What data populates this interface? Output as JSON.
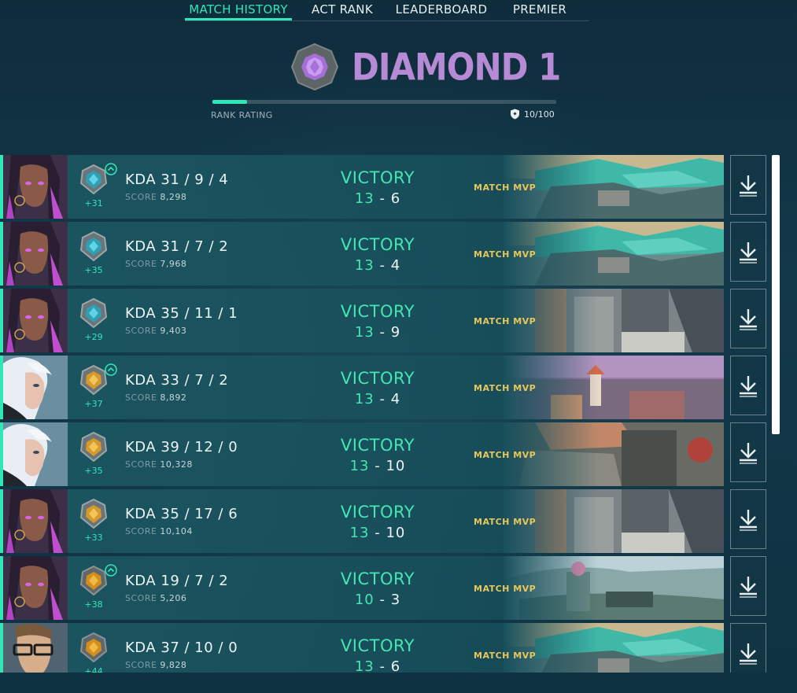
{
  "tabs": [
    {
      "label": "MATCH HISTORY",
      "active": true
    },
    {
      "label": "ACT RANK",
      "active": false
    },
    {
      "label": "LEADERBOARD",
      "active": false
    },
    {
      "label": "PREMIER",
      "active": false
    }
  ],
  "rank": {
    "name": "DIAMOND 1",
    "rating_label": "RANK RATING",
    "rating_value": "10/100",
    "rating_fraction": 0.1,
    "color": "#b78ad6"
  },
  "colors": {
    "accent": "#2ee8b8",
    "victory": "#45e5b4",
    "mvp": "#e6c75c"
  },
  "matches": [
    {
      "agent": "reyna",
      "badge": "platinum",
      "promoted": true,
      "rr": "+31",
      "kda": "KDA 31 / 9 / 4",
      "score_label": "SCORE",
      "score": "8,298",
      "result": "VICTORY",
      "team_score": "13",
      "sep": "-",
      "enemy_score": "6",
      "mvp": "MATCH MVP",
      "map": "ascent"
    },
    {
      "agent": "reyna",
      "badge": "platinum",
      "promoted": false,
      "rr": "+35",
      "kda": "KDA 31 / 7 / 2",
      "score_label": "SCORE",
      "score": "7,968",
      "result": "VICTORY",
      "team_score": "13",
      "sep": "-",
      "enemy_score": "4",
      "mvp": "MATCH MVP",
      "map": "ascent"
    },
    {
      "agent": "reyna",
      "badge": "platinum",
      "promoted": false,
      "rr": "+29",
      "kda": "KDA 35 / 11 / 1",
      "score_label": "SCORE",
      "score": "9,403",
      "result": "VICTORY",
      "team_score": "13",
      "sep": "-",
      "enemy_score": "9",
      "mvp": "MATCH MVP",
      "map": "bind"
    },
    {
      "agent": "jett",
      "badge": "gold",
      "promoted": true,
      "rr": "+37",
      "kda": "KDA 33 / 7 / 2",
      "score_label": "SCORE",
      "score": "8,892",
      "result": "VICTORY",
      "team_score": "13",
      "sep": "-",
      "enemy_score": "4",
      "mvp": "MATCH MVP",
      "map": "split"
    },
    {
      "agent": "jett",
      "badge": "gold",
      "promoted": false,
      "rr": "+35",
      "kda": "KDA 39 / 12 / 0",
      "score_label": "SCORE",
      "score": "10,328",
      "result": "VICTORY",
      "team_score": "13",
      "sep": "-",
      "enemy_score": "10",
      "mvp": "MATCH MVP",
      "map": "haven"
    },
    {
      "agent": "reyna",
      "badge": "gold",
      "promoted": false,
      "rr": "+33",
      "kda": "KDA 35 / 17 / 6",
      "score_label": "SCORE",
      "score": "10,104",
      "result": "VICTORY",
      "team_score": "13",
      "sep": "-",
      "enemy_score": "10",
      "mvp": "MATCH MVP",
      "map": "bind"
    },
    {
      "agent": "reyna",
      "badge": "silver",
      "promoted": true,
      "rr": "+38",
      "kda": "KDA 19 / 7 / 2",
      "score_label": "SCORE",
      "score": "5,206",
      "result": "VICTORY",
      "team_score": "10",
      "sep": "-",
      "enemy_score": "3",
      "mvp": "MATCH MVP",
      "map": "icebox"
    },
    {
      "agent": "chamber",
      "badge": "silver",
      "promoted": false,
      "rr": "+44",
      "kda": "KDA 37 / 10 / 0",
      "score_label": "SCORE",
      "score": "9,828",
      "result": "VICTORY",
      "team_score": "13",
      "sep": "-",
      "enemy_score": "6",
      "mvp": "MATCH MVP",
      "map": "ascent"
    }
  ]
}
